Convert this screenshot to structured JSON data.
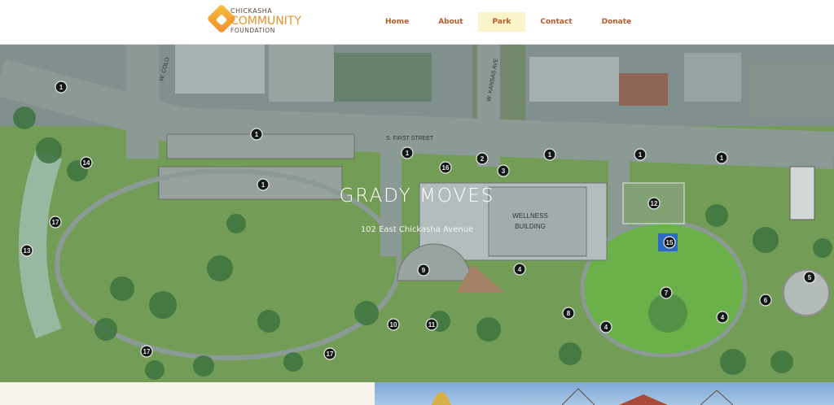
{
  "logo": {
    "line1": "CHICKASHA",
    "line2": "COMMUNITY",
    "line3": "FOUNDATION"
  },
  "nav": {
    "items": [
      {
        "label": "Home"
      },
      {
        "label": "About"
      },
      {
        "label": "Park",
        "active": true
      },
      {
        "label": "Contact"
      },
      {
        "label": "Donate"
      }
    ]
  },
  "hero": {
    "title": "GRADY MOVES",
    "subtitle": "102 East Chickasha Avenue"
  },
  "map": {
    "streets": {
      "first_street": "S. FIRST STREET",
      "colorado": "W. COLO",
      "kansas": "W. KANSAS AVE"
    },
    "building_label_line1": "WELLNESS",
    "building_label_line2": "BUILDING",
    "markers": [
      "1",
      "1",
      "1",
      "1",
      "1",
      "1",
      "1",
      "2",
      "3",
      "16",
      "14",
      "17",
      "13",
      "12",
      "15",
      "9",
      "4",
      "7",
      "8",
      "4",
      "4",
      "6",
      "5",
      "10",
      "11",
      "17",
      "17"
    ]
  },
  "colors": {
    "grass": "#7ea85a",
    "path": "#9aa5a2",
    "nav_text": "#b45b2c",
    "nav_active_bg": "#fbf3c9"
  }
}
